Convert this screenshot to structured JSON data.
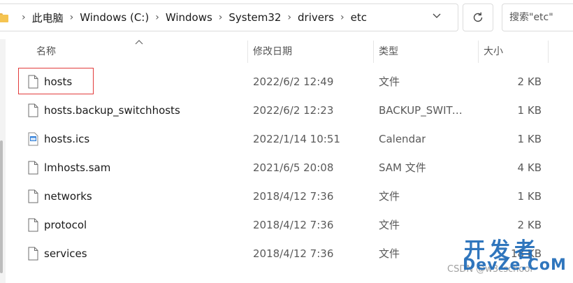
{
  "address_bar": {
    "breadcrumbs": [
      "此电脑",
      "Windows (C:)",
      "Windows",
      "System32",
      "drivers",
      "etc"
    ]
  },
  "search": {
    "placeholder": "搜索\"etc\""
  },
  "columns": {
    "name": "名称",
    "date": "修改日期",
    "type": "类型",
    "size": "大小"
  },
  "files": [
    {
      "name": "hosts",
      "date": "2022/6/2 12:49",
      "type": "文件",
      "size": "2 KB",
      "icon": "file-icon"
    },
    {
      "name": "hosts.backup_switchhosts",
      "date": "2022/6/2 12:23",
      "type": "BACKUP_SWITC...",
      "size": "1 KB",
      "icon": "file-icon"
    },
    {
      "name": "hosts.ics",
      "date": "2022/1/14 10:51",
      "type": "Calendar",
      "size": "1 KB",
      "icon": "calendar-file-icon"
    },
    {
      "name": "lmhosts.sam",
      "date": "2021/6/5 20:08",
      "type": "SAM 文件",
      "size": "4 KB",
      "icon": "file-icon"
    },
    {
      "name": "networks",
      "date": "2018/4/12 7:36",
      "type": "文件",
      "size": "1 KB",
      "icon": "file-icon"
    },
    {
      "name": "protocol",
      "date": "2018/4/12 7:36",
      "type": "文件",
      "size": "2 KB",
      "icon": "file-icon"
    },
    {
      "name": "services",
      "date": "2018/4/12 7:36",
      "type": "文件",
      "size": "18 KB",
      "icon": "file-icon"
    }
  ],
  "watermark": {
    "title": "开发者",
    "url": "DevZe.CoM",
    "small": "CSDN @w3cschool"
  },
  "colors": {
    "highlight": "#e23b3b",
    "watermark": "#1f6bb8",
    "folder": "#f5c451"
  }
}
